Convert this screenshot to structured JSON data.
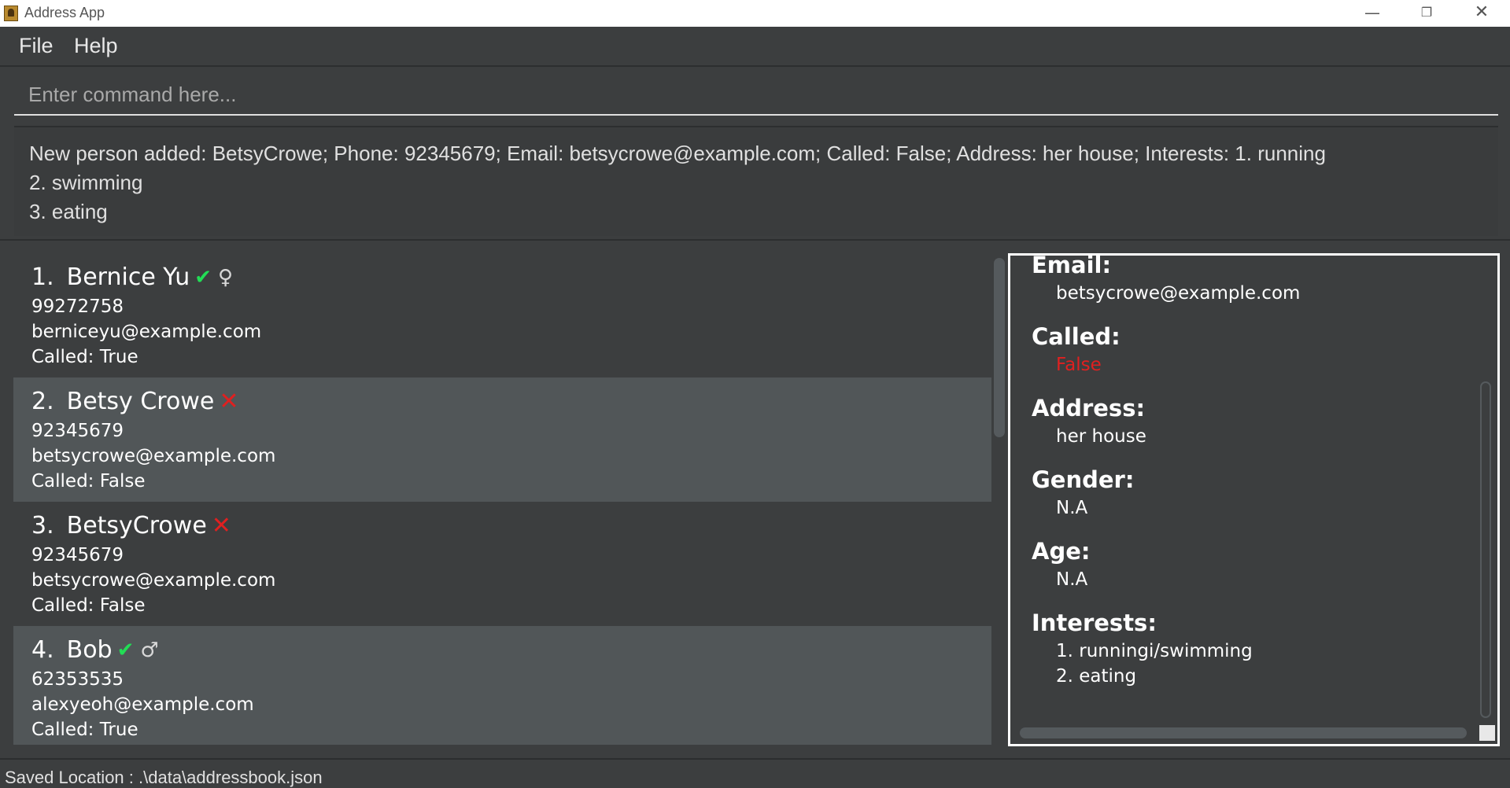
{
  "window": {
    "title": "Address App",
    "minimize_glyph": "—",
    "maximize_glyph": "❐",
    "close_glyph": "✕"
  },
  "menu": {
    "file": "File",
    "help": "Help"
  },
  "command": {
    "placeholder": "Enter command here...",
    "value": ""
  },
  "result": {
    "line1": "New person added: BetsyCrowe; Phone: 92345679; Email: betsycrowe@example.com; Called: False; Address: her house; Interests: 1. running",
    "line2": "2. swimming",
    "line3": "3. eating"
  },
  "persons": [
    {
      "index": "1.",
      "name": "Bernice Yu",
      "status_icon": "check-icon",
      "status_glyph": "✔",
      "gender_glyph": "♀",
      "phone": "99272758",
      "email": "berniceyu@example.com",
      "called": "Called: True"
    },
    {
      "index": "2.",
      "name": "Betsy Crowe",
      "status_icon": "cross-icon",
      "status_glyph": "✕",
      "gender_glyph": "",
      "phone": "92345679",
      "email": "betsycrowe@example.com",
      "called": "Called: False"
    },
    {
      "index": "3.",
      "name": "BetsyCrowe",
      "status_icon": "cross-icon",
      "status_glyph": "✕",
      "gender_glyph": "",
      "phone": "92345679",
      "email": "betsycrowe@example.com",
      "called": "Called: False"
    },
    {
      "index": "4.",
      "name": "Bob",
      "status_icon": "check-icon",
      "status_glyph": "✔",
      "gender_glyph": "♂",
      "phone": "62353535",
      "email": "alexyeoh@example.com",
      "called": "Called: True"
    }
  ],
  "detail": {
    "email_label": "Email:",
    "email": "betsycrowe@example.com",
    "called_label": "Called:",
    "called": "False",
    "address_label": "Address:",
    "address": "her house",
    "gender_label": "Gender:",
    "gender": "N.A",
    "age_label": "Age:",
    "age": "N.A",
    "interests_label": "Interests:",
    "interests": [
      "1. runningi/swimming",
      "2. eating"
    ]
  },
  "colors": {
    "called_true": "#22dd55",
    "called_false": "#e02020",
    "background": "#3c3e3f",
    "selected_row": "#515658"
  },
  "status": {
    "saved_location": "Saved Location : .\\data\\addressbook.json"
  }
}
